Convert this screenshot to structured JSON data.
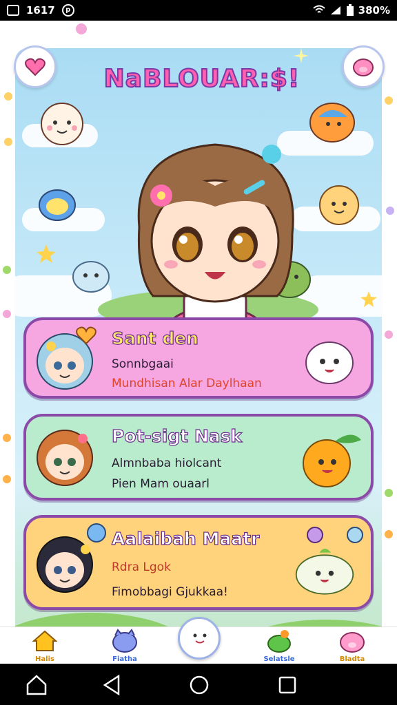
{
  "status_bar": {
    "time": "1617",
    "battery": "380%"
  },
  "app": {
    "title": "NaBLOUAR:$!"
  },
  "cards": [
    {
      "title": "Sant den",
      "line1": "Sonnbgaai",
      "line2": "Mundhisan Alar Daylhaan"
    },
    {
      "title": "Pot-sigt Nask",
      "line1": "Almnbaba hiolcant",
      "line2": "Pien Mam ouaarl"
    },
    {
      "title": "Aalaibah Maatr",
      "line1": "Rdra Lgok",
      "line2": "Fimobbagi Gjukkaa!"
    }
  ],
  "bottom_nav": {
    "items": [
      {
        "label": "Halis",
        "icon": "house-icon"
      },
      {
        "label": "Fiatha",
        "icon": "cat-icon"
      },
      {
        "label": "Selatsle",
        "icon": "frog-icon"
      },
      {
        "label": "Bladta",
        "icon": "pig-icon"
      }
    ]
  },
  "colors": {
    "title_pink": "#ff5fb0",
    "card1": "#f6a6e0",
    "card2": "#b9eccd",
    "card3": "#ffd27c",
    "border_purple": "#8c4aa8"
  }
}
